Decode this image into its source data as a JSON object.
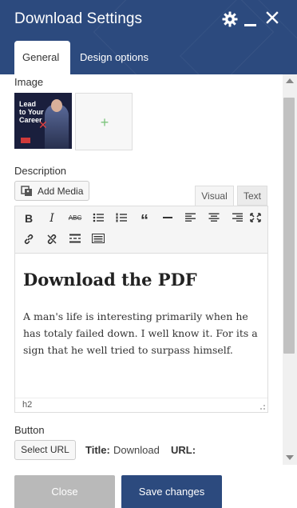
{
  "header": {
    "title": "Download Settings",
    "bg_color": "#2c4a7e",
    "icons": [
      "gear-icon",
      "minimize-icon",
      "close-icon"
    ]
  },
  "tabs": [
    {
      "label": "General",
      "active": true
    },
    {
      "label": "Design options",
      "active": false
    }
  ],
  "image_section": {
    "label": "Image",
    "thumbnail_text": "Lead to Your Career",
    "add_symbol": "+"
  },
  "description": {
    "label": "Description",
    "add_media_label": "Add Media",
    "editor_tabs": [
      {
        "label": "Visual",
        "active": true
      },
      {
        "label": "Text",
        "active": false
      }
    ],
    "toolbar_row1": [
      "bold-icon",
      "italic-icon",
      "strikethrough-icon",
      "bullet-list-icon",
      "numbered-list-icon",
      "blockquote-icon",
      "horizontal-line-icon",
      "align-left-icon",
      "align-center-icon",
      "align-right-icon",
      "fullscreen-icon"
    ],
    "toolbar_row2": [
      "link-icon",
      "unlink-icon",
      "read-more-icon",
      "toolbar-toggle-icon"
    ],
    "heading": "Download the PDF",
    "body": "A man's life is interesting primarily when he has totaly failed down. I well know it. For its a sign that he well tried to surpass himself.",
    "status_path": "h2"
  },
  "button_section": {
    "label": "Button",
    "select_url_label": "Select URL",
    "title_label": "Title:",
    "title_value": "Download",
    "url_label": "URL:"
  },
  "footer": {
    "close_label": "Close",
    "save_label": "Save changes"
  }
}
